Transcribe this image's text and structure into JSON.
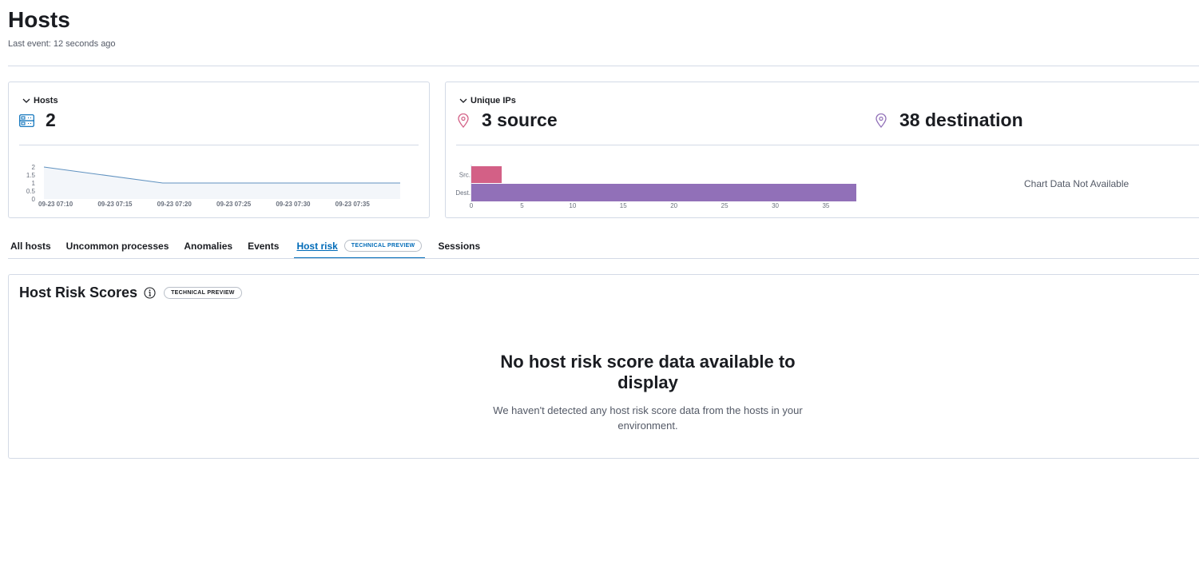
{
  "page": {
    "title": "Hosts",
    "last_event": "Last event: 12 seconds ago"
  },
  "kpi_hosts": {
    "title": "Hosts",
    "value": "2"
  },
  "kpi_unique_ips": {
    "title": "Unique IPs",
    "source_value": "3 source",
    "destination_value": "38 destination",
    "no_data_text": "Chart Data Not Available"
  },
  "tabs": [
    {
      "label": "All hosts"
    },
    {
      "label": "Uncommon processes"
    },
    {
      "label": "Anomalies"
    },
    {
      "label": "Events"
    },
    {
      "label": "Host risk",
      "badge": "TECHNICAL PREVIEW",
      "active": true
    },
    {
      "label": "Sessions"
    }
  ],
  "risk_panel": {
    "title": "Host Risk Scores",
    "badge": "TECHNICAL PREVIEW",
    "empty_title": "No host risk score data available to display",
    "empty_body": "We haven't detected any host risk score data from the hosts in your environment."
  },
  "colors": {
    "accent": "#006bb8",
    "source": "#d36086",
    "destination": "#9170b8",
    "line": "#6092c0"
  },
  "chart_data": [
    {
      "type": "area",
      "x": [
        "09-23 07:10",
        "09-23 07:20",
        "09-23 07:40"
      ],
      "values": [
        2,
        1,
        1
      ],
      "xticks": [
        "09-23 07:10",
        "09-23 07:15",
        "09-23 07:20",
        "09-23 07:25",
        "09-23 07:30",
        "09-23 07:35"
      ],
      "yticks": [
        "2",
        "1.5",
        "1",
        "0.5",
        "0"
      ],
      "ylim": [
        0,
        2
      ]
    },
    {
      "type": "bar",
      "orientation": "horizontal",
      "categories": [
        "Src.",
        "Dest."
      ],
      "values": [
        3,
        38
      ],
      "xticks": [
        "0",
        "5",
        "10",
        "15",
        "20",
        "25",
        "30",
        "35"
      ],
      "xlim": [
        0,
        38
      ]
    }
  ]
}
